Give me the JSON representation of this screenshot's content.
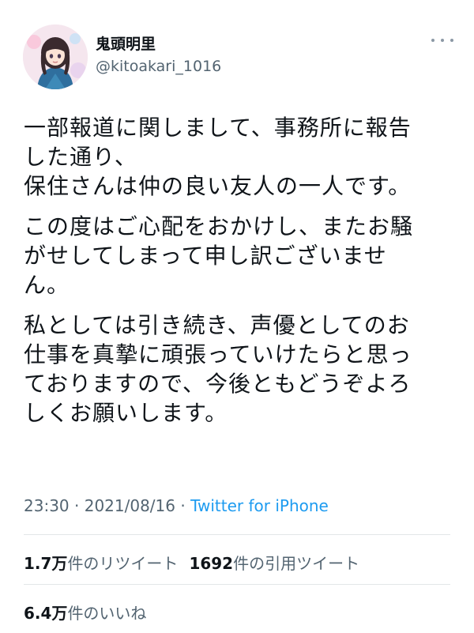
{
  "author": {
    "display_name": "鬼頭明里",
    "handle": "@kitoakari_1016"
  },
  "tweet": {
    "paragraphs": [
      [
        "一部報道に関しまして、事務所に報告",
        "した通り、",
        "保住さんは仲の良い友人の一人です。"
      ],
      [
        "この度はご心配をおかけし、またお騒",
        "がせしてしまって申し訳ございませ",
        "ん。"
      ],
      [
        "私としては引き続き、声優としてのお",
        "仕事を真摯に頑張っていけたらと思っ",
        "ておりますので、今後ともどうぞよろ",
        "しくお願いします。"
      ]
    ],
    "time": "23:30",
    "date": "2021/08/16",
    "separator": "·",
    "source": "Twitter for iPhone"
  },
  "stats": {
    "retweets_count": "1.7万",
    "retweets_label": "件のリツイート",
    "quotes_count": "1692",
    "quotes_label": "件の引用ツイート",
    "likes_count": "6.4万",
    "likes_label": "件のいいね"
  },
  "icons": {
    "more": "more-horizontal-icon",
    "avatar": "avatar"
  }
}
